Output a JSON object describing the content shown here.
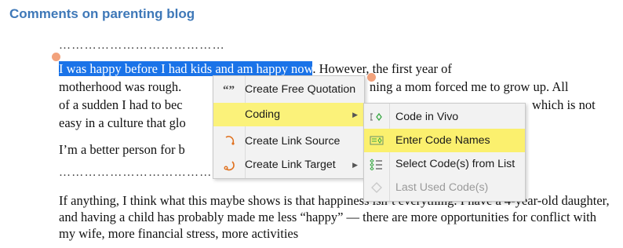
{
  "heading": "Comments on parenting blog",
  "dots": "…………………………………",
  "paragraph1": {
    "line1_selected": "I was happy before I had kids and am happy now",
    "line1_rest": ". However, the first year of",
    "line2a": "motherhood was rough.",
    "line2b": "ning a mom forced me to grow up. All",
    "line3a": "of a sudden I had to bec",
    "line3b": "which is not",
    "line4": "easy in a culture that glo"
  },
  "paragraph2": "I’m a better person for b",
  "paragraph3": "If anything, I think what this maybe shows is that happiness isn’t everything. I have a 4-year-old daughter, and having a child has probably made me less “happy” — there are more opportunities for conflict with my wife, more financial stress, more activities",
  "context_menu": {
    "items": [
      {
        "label": "Create Free Quotation",
        "icon": "quote-icon"
      },
      {
        "label": "Coding",
        "icon": "",
        "submenu": true
      },
      {
        "label": "Create Link Source",
        "icon": "link-source-icon"
      },
      {
        "label": "Create Link Target",
        "icon": "link-target-icon",
        "submenu": true
      }
    ]
  },
  "coding_submenu": {
    "items": [
      {
        "label": "Code in Vivo",
        "icon": "code-in-vivo-icon"
      },
      {
        "label": "Enter Code Names",
        "icon": "enter-code-names-icon"
      },
      {
        "label": "Select Code(s) from List",
        "icon": "code-list-icon"
      },
      {
        "label": "Last Used Code(s)",
        "icon": "last-used-code-icon",
        "disabled": true
      }
    ]
  },
  "colors": {
    "heading": "#3e78b8",
    "selection": "#1a73e8",
    "highlight": "#fbf27a",
    "handle": "#f2a27c"
  }
}
